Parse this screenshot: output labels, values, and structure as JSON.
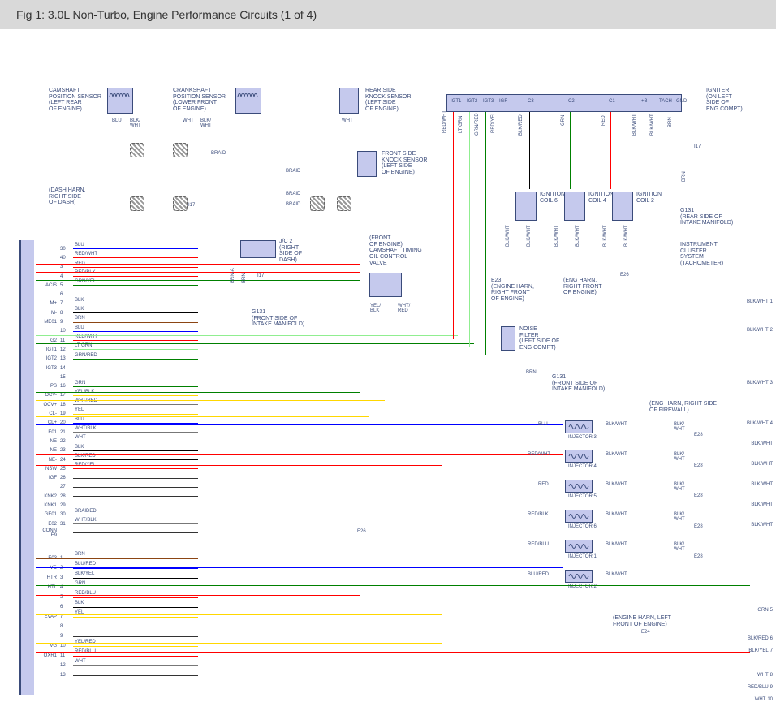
{
  "header": {
    "title": "Fig 1: 3.0L Non-Turbo, Engine Performance Circuits (1 of 4)"
  },
  "components": {
    "camshaft_sensor": {
      "title": "CAMSHAFT\nPOSITION SENSOR\n(LEFT REAR\nOF ENGINE)"
    },
    "crankshaft_sensor": {
      "title": "CRANKSHAFT\nPOSITION SENSOR\n(LOWER FRONT\nOF ENGINE)"
    },
    "rear_knock": {
      "title": "REAR SIDE\nKNOCK SENSOR\n(LEFT SIDE\nOF ENGINE)"
    },
    "front_knock": {
      "title": "FRONT SIDE\nKNOCK SENSOR\n(LEFT SIDE\nOF ENGINE)"
    },
    "igniter": {
      "title": "IGNITER\n(ON LEFT\nSIDE OF\nENG COMPT)"
    },
    "jc2": {
      "title": "J/C 2\n(RIGHT\nSIDE OF\nDASH)"
    },
    "oil_valve": {
      "title": "(FRONT\nOF ENGINE)\nCAMSHAFT TIMING\nOIL CONTROL\nVALVE"
    },
    "coil6": {
      "title": "IGNITION\nCOIL 6"
    },
    "coil4": {
      "title": "IGNITION\nCOIL 4"
    },
    "coil2": {
      "title": "IGNITION\nCOIL 2"
    },
    "noise_filter": {
      "title": "NOISE\nFILTER\n(LEFT SIDE OF\nENG COMPT)"
    },
    "g131_rear": {
      "title": "G131\n(REAR SIDE OF\nINTAKE MANIFOLD)"
    },
    "g131_front": {
      "title": "G131\n(FRONT SIDE OF\nINTAKE MANIFOLD)"
    },
    "g131_front2": {
      "title": "G131\n(FRONT SIDE OF\nINTAKE MANIFOLD)"
    },
    "cluster": {
      "title": "INSTRUMENT\nCLUSTER\nSYSTEM\n(TACHOMETER)"
    },
    "dash_harn": {
      "title": "(DASH HARN,\nRIGHT SIDE\nOF DASH)"
    },
    "e23": {
      "title": "E23\n(ENGINE HARN,\nRIGHT FRONT\nOF ENGINE)"
    },
    "eng_harn_front": {
      "title": "(ENG HARN,\nRIGHT FRONT\nOF ENGINE)"
    },
    "eng_harn_firewall": {
      "title": "(ENG HARN, RIGHT SIDE\nOF FIREWALL)"
    },
    "eng_harn_left": {
      "title": "(ENGINE HARN, LEFT\nFRONT OF ENGINE)"
    }
  },
  "igniter_pins": [
    "IGT1",
    "IGT2",
    "IGT3",
    "IGF",
    "C3-",
    "C2-",
    "C1-",
    "+B",
    "TACH",
    "GND"
  ],
  "injectors": [
    "INJECTOR 3",
    "INJECTOR 4",
    "INJECTOR 5",
    "INJECTOR 6",
    "INJECTOR 1",
    "INJECTOR 2"
  ],
  "ecu_pins": [
    {
      "n": "30",
      "sig": "",
      "c": "BLU"
    },
    {
      "n": "40",
      "sig": "",
      "c": "RED/WHT"
    },
    {
      "n": "3",
      "sig": "",
      "c": "RED"
    },
    {
      "n": "4",
      "sig": "",
      "c": "RED/BLK"
    },
    {
      "n": "5",
      "sig": "ACIS",
      "c": "GRN/YEL"
    },
    {
      "n": "6",
      "sig": "",
      "c": ""
    },
    {
      "n": "7",
      "sig": "M+",
      "c": "BLK"
    },
    {
      "n": "8",
      "sig": "M-",
      "c": "BLK"
    },
    {
      "n": "9",
      "sig": "ME01",
      "c": "BRN"
    },
    {
      "n": "10",
      "sig": "",
      "c": "BLU"
    },
    {
      "n": "11",
      "sig": "G2",
      "c": "RED/WHT"
    },
    {
      "n": "12",
      "sig": "IGT1",
      "c": "LT GRN"
    },
    {
      "n": "13",
      "sig": "IGT2",
      "c": "GRN/RED"
    },
    {
      "n": "14",
      "sig": "IGT3",
      "c": ""
    },
    {
      "n": "15",
      "sig": "",
      "c": ""
    },
    {
      "n": "16",
      "sig": "PS",
      "c": "GRN"
    },
    {
      "n": "17",
      "sig": "OCV-",
      "c": "YEL/BLK"
    },
    {
      "n": "18",
      "sig": "OCV+",
      "c": "WHT/RED"
    },
    {
      "n": "19",
      "sig": "CL-",
      "c": "YEL"
    },
    {
      "n": "20",
      "sig": "CL+",
      "c": "BLU"
    },
    {
      "n": "21",
      "sig": "E01",
      "c": "WHT/BLK"
    },
    {
      "n": "22",
      "sig": "NE",
      "c": "WHT"
    },
    {
      "n": "23",
      "sig": "NE",
      "c": "BLK"
    },
    {
      "n": "24",
      "sig": "NE-",
      "c": "BLK/RED"
    },
    {
      "n": "25",
      "sig": "NSW",
      "c": "RED/YEL"
    },
    {
      "n": "26",
      "sig": "IGF",
      "c": ""
    },
    {
      "n": "27",
      "sig": "",
      "c": ""
    },
    {
      "n": "28",
      "sig": "KNK2",
      "c": ""
    },
    {
      "n": "29",
      "sig": "KNK1",
      "c": ""
    },
    {
      "n": "30",
      "sig": "GE01",
      "c": "BRAIDED"
    },
    {
      "n": "31",
      "sig": "E02",
      "c": "WHT/BLK"
    },
    {
      "n": "",
      "sig": "CONN E9",
      "c": ""
    }
  ],
  "ecu_pins2": [
    {
      "n": "1",
      "sig": "E03",
      "c": "BRN"
    },
    {
      "n": "2",
      "sig": "VC",
      "c": "BLU/RED"
    },
    {
      "n": "3",
      "sig": "HTR",
      "c": "BLK/YEL"
    },
    {
      "n": "4",
      "sig": "HTL",
      "c": "GRN"
    },
    {
      "n": "5",
      "sig": "",
      "c": "RED/BLU"
    },
    {
      "n": "6",
      "sig": "",
      "c": "BLK"
    },
    {
      "n": "7",
      "sig": "EVAP",
      "c": "YEL"
    },
    {
      "n": "8",
      "sig": "",
      "c": ""
    },
    {
      "n": "9",
      "sig": "",
      "c": ""
    },
    {
      "n": "10",
      "sig": "VG",
      "c": "YEL/RED"
    },
    {
      "n": "11",
      "sig": "OXR1",
      "c": "RED/BLU"
    },
    {
      "n": "12",
      "sig": "",
      "c": "WHT"
    },
    {
      "n": "13",
      "sig": "",
      "c": ""
    }
  ],
  "right_pins": [
    {
      "n": "1",
      "c": "BLK/WHT"
    },
    {
      "n": "2",
      "c": "BLK/WHT"
    },
    {
      "n": "3",
      "c": "BLK/WHT"
    },
    {
      "n": "4",
      "c": "BLK/WHT"
    },
    {
      "n": "",
      "c": "BLK/WHT"
    },
    {
      "n": "",
      "c": "BLK/WHT"
    },
    {
      "n": "",
      "c": "BLK/WHT"
    },
    {
      "n": "",
      "c": "BLK/WHT"
    },
    {
      "n": "",
      "c": "BLK/WHT"
    },
    {
      "n": "5",
      "c": "GRN"
    },
    {
      "n": "6",
      "c": "BLK/RED"
    },
    {
      "n": "7",
      "c": "BLK/YEL"
    },
    {
      "n": "8",
      "c": "WHT"
    },
    {
      "n": "9",
      "c": "RED/BLU"
    },
    {
      "n": "10",
      "c": "WHT"
    }
  ],
  "wire_labels": {
    "blu": "BLU",
    "blk_wht": "BLK/\nWHT",
    "wht": "WHT",
    "braid": "BRAID",
    "brn": "BRN",
    "brn_a": "BRN-A",
    "red_wht": "RED/WHT",
    "lt_grn": "LT GRN",
    "grn_red": "GRN/RED",
    "red_yel": "RED/YEL",
    "blk_red": "BLK/RED",
    "red": "RED",
    "grn": "GRN",
    "red_blk": "RED/BLK",
    "red_blu": "RED/BLU",
    "blu_red": "BLU/RED",
    "yel_blk": "YEL/\nBLK",
    "wht_red": "WHT/\nRED",
    "i17": "I17",
    "e26": "E26",
    "e28": "E28",
    "e24": "E24",
    "blk_wht_h": "BLK/WHT",
    "blk_wht2": "BLK/\nWHT"
  },
  "colors": {
    "blu": "#0000ff",
    "red": "#ff0000",
    "grn": "#008000",
    "yel": "#ffd700",
    "brn": "#8b4513",
    "blk": "#000000",
    "wht": "#888888",
    "ltgrn": "#90ee90",
    "orange": "#ff8c00"
  }
}
